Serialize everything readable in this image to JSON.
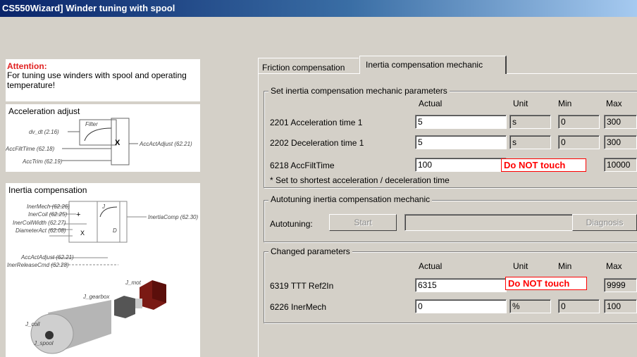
{
  "window": {
    "title": "CS550Wizard] Winder tuning with spool"
  },
  "left": {
    "attention_title": "Attention:",
    "attention_text": "For tuning use winders with spool and operating temperature!",
    "accel": {
      "title": "Acceleration adjust",
      "labels": [
        "dv_dt (2.16)",
        "AccFiltTime (62.18)",
        "AccTrim (62.19)",
        "Filter",
        "X",
        "AccActAdjust (62.21)"
      ]
    },
    "inertia": {
      "title": "Inertia compensation",
      "labels": [
        "InerMech (62.26)",
        "InerCoil (62.25)",
        "InerCoilWidth (62.27)",
        "DiameterAct (62.08)",
        "AccActAdjust (62.21)",
        "InerReleaseCmd (62.28)",
        "InertiaComp (62.30)",
        "+",
        "X",
        "J",
        "D"
      ],
      "inertia_labels": [
        "J_mot",
        "J_gearbox",
        "J_coil",
        "J_spool"
      ]
    }
  },
  "tabs": [
    "Friction compensation",
    "Inertia compensation mechanic"
  ],
  "set_group": {
    "title": "Set inertia compensation mechanic parameters",
    "headers": [
      "Actual",
      "Unit",
      "Min",
      "Max"
    ],
    "rows": [
      {
        "label": "2201 Acceleration time 1",
        "actual": "5",
        "unit": "s",
        "min": "0",
        "max": "300"
      },
      {
        "label": "2202 Deceleration time 1",
        "actual": "5",
        "unit": "s",
        "min": "0",
        "max": "300"
      },
      {
        "label": "6218 AccFiltTime",
        "actual": "100",
        "warning": "Do NOT touch",
        "max": "10000"
      }
    ],
    "note": "* Set to shortest acceleration / deceleration time"
  },
  "auto_group": {
    "title": "Autotuning inertia compensation mechanic",
    "label": "Autotuning:",
    "start": "Start",
    "diagnosis": "Diagnosis"
  },
  "changed_group": {
    "title": "Changed parameters",
    "headers": [
      "Actual",
      "Unit",
      "Min",
      "Max"
    ],
    "rows": [
      {
        "label": "6319 TTT Ref2In",
        "actual": "6315",
        "warning": "Do NOT touch",
        "max": "9999"
      },
      {
        "label": "6226 InerMech",
        "actual": "0",
        "unit": "%",
        "min": "0",
        "max": "100"
      }
    ]
  },
  "colors": {
    "warning": "#ff0000",
    "attention": "#e02020",
    "title_bar": "#0a246a"
  }
}
